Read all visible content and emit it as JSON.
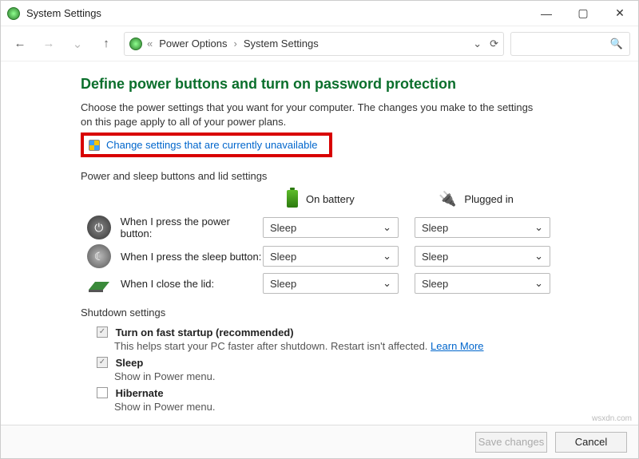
{
  "window": {
    "title": "System Settings"
  },
  "breadcrumb": {
    "a": "Power Options",
    "b": "System Settings"
  },
  "main": {
    "heading": "Define power buttons and turn on password protection",
    "description": "Choose the power settings that you want for your computer. The changes you make to the settings on this page apply to all of your power plans.",
    "change_link": "Change settings that are currently unavailable",
    "section1": "Power and sleep buttons and lid settings",
    "col_battery": "On battery",
    "col_plugged": "Plugged in",
    "rows": {
      "power": {
        "label": "When I press the power button:",
        "battery": "Sleep",
        "plugged": "Sleep"
      },
      "sleep": {
        "label": "When I press the sleep button:",
        "battery": "Sleep",
        "plugged": "Sleep"
      },
      "lid": {
        "label": "When I close the lid:",
        "battery": "Sleep",
        "plugged": "Sleep"
      }
    },
    "shutdown": {
      "heading": "Shutdown settings",
      "fast": {
        "title": "Turn on fast startup (recommended)",
        "sub": "This helps start your PC faster after shutdown. Restart isn't affected.",
        "learn": "Learn More"
      },
      "sleep": {
        "title": "Sleep",
        "sub": "Show in Power menu."
      },
      "hiber": {
        "title": "Hibernate",
        "sub": "Show in Power menu."
      }
    }
  },
  "footer": {
    "save": "Save changes",
    "cancel": "Cancel"
  },
  "watermark": "wsxdn.com"
}
